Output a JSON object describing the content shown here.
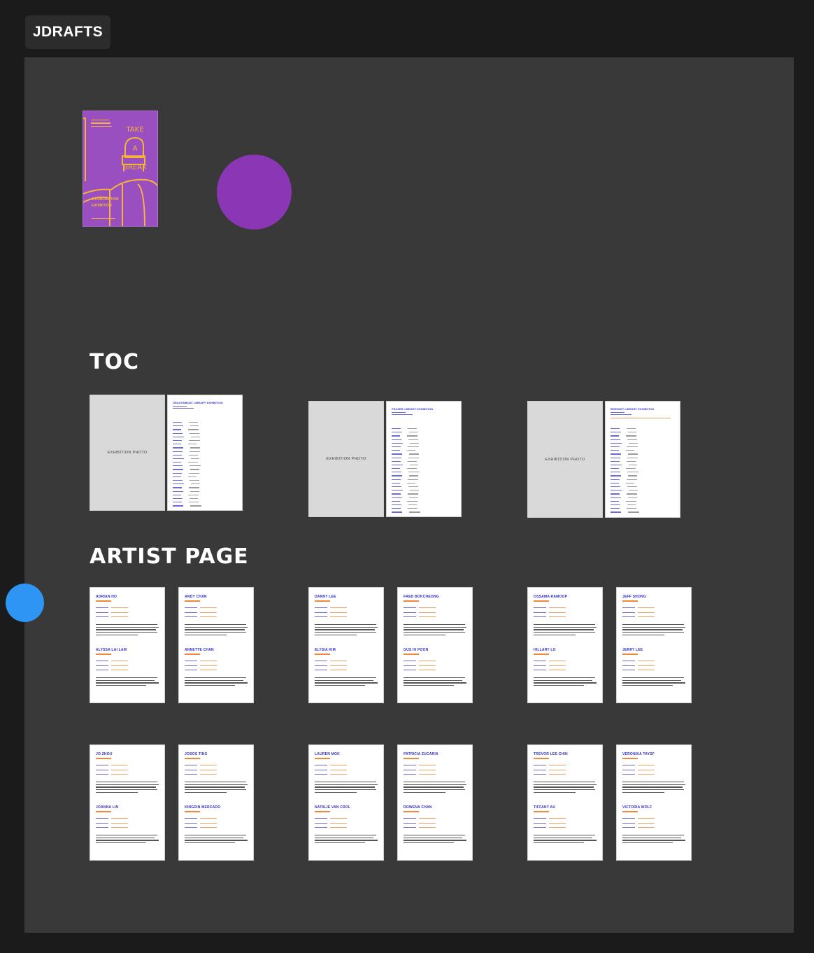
{
  "app": {
    "name": "JDRAFTS"
  },
  "cover": {
    "title_lines": [
      "TAKE",
      "A",
      "BREAK"
    ],
    "subtitle_lines": [
      "A PUBLICATION",
      "EXHIBITION"
    ]
  },
  "sections": {
    "toc": "TOC",
    "artist": "ARTIST PAGE"
  },
  "toc_spreads": [
    {
      "photo_label": "EXHIBITION PHOTO",
      "heading": "DRAGONBOAT LIBRARY EXHIBITION"
    },
    {
      "photo_label": "EXHIBITION PHOTO",
      "heading": "FRASER LIBRARY EXHIBITION"
    },
    {
      "photo_label": "EXHIBITION PHOTO",
      "heading": "BRENNET LIBRARY EXHIBITION"
    }
  ],
  "artist_pages": [
    [
      "ADRIAN HO",
      "ALYSSA LAI LAM"
    ],
    [
      "ANDY CHAN",
      "ANNETTE CHAN"
    ],
    [
      "DANNY LEE",
      "ELYSIA KIM"
    ],
    [
      "FRED BOKCHEONG",
      "GUS HI POON"
    ],
    [
      "OSSAMA RAMOOP",
      "HILLARY LO"
    ],
    [
      "JEFF SHONG",
      "JERRY LEE"
    ],
    [
      "JO ZHOU",
      "JOANNA LIN"
    ],
    [
      "JOSOS TING",
      "KINGDIN MERCADO"
    ],
    [
      "LAUREN MOK",
      "NATALIE VAN CROL"
    ],
    [
      "PATRICIA ZUCARIA",
      "ROWENA CHAN"
    ],
    [
      "TREVOR LEE-CHIN",
      "TIFFANY AU"
    ],
    [
      "VERONIKA TAYSF",
      "VICTORIA WOLF"
    ]
  ],
  "colors": {
    "canvas": "#393939",
    "cover_bg": "#9a4fc0",
    "cover_accent": "#f4b43c",
    "accent_circle": "#8b36b4",
    "handle": "#2f95f5",
    "artist_name": "#2f2fc8",
    "artist_tag": "#f0883c"
  }
}
